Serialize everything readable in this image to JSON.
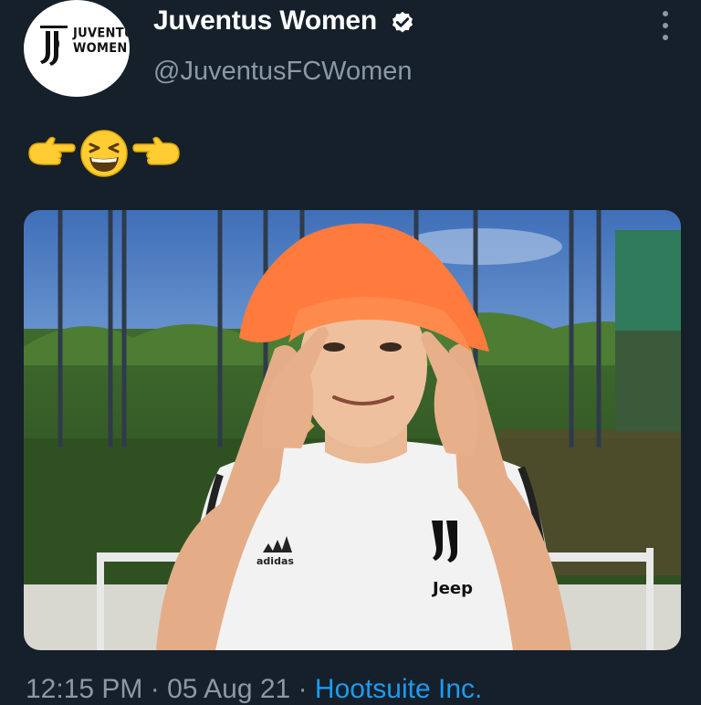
{
  "profile": {
    "display_name": "Juventus Women",
    "handle": "@JuventusFCWomen",
    "avatar_line1": "JUVENTUS",
    "avatar_line2": "WOMEN",
    "verified": true
  },
  "tweet": {
    "emojis": [
      "backhand-index-pointing-right",
      "grinning-squinting-face",
      "backhand-index-pointing-left"
    ],
    "media": {
      "jersey_brand": "adidas",
      "jersey_sponsor": "Jeep"
    }
  },
  "meta": {
    "time": "12:15 PM",
    "separator": " · ",
    "date": "05 Aug 21",
    "source": "Hootsuite Inc."
  },
  "colors": {
    "background": "#15202b",
    "secondary_text": "#8b98a5",
    "link": "#1d9bf0",
    "hat": "#ff7a3d"
  }
}
